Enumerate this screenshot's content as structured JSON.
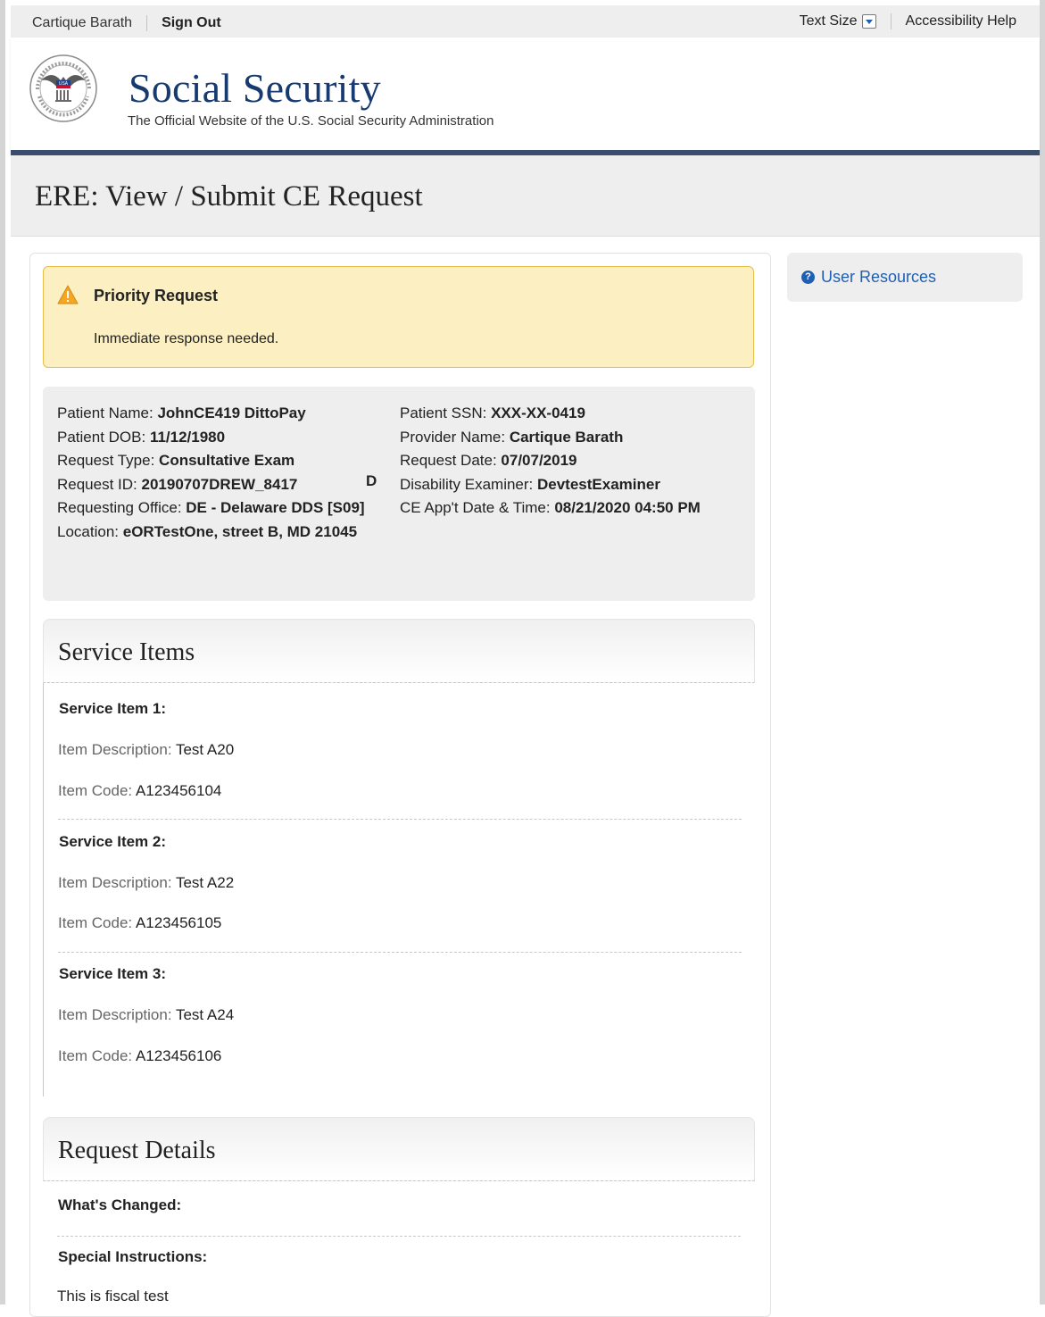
{
  "utility_bar": {
    "user_name": "Cartique Barath",
    "sign_out": "Sign Out",
    "text_size": "Text Size",
    "accessibility_help": "Accessibility Help"
  },
  "header": {
    "title": "Social Security",
    "subtitle": "The Official Website of the U.S. Social Security Administration",
    "logo_text": "USA"
  },
  "page_title": "ERE: View / Submit CE Request",
  "alert": {
    "title": "Priority Request",
    "message": "Immediate response needed."
  },
  "patient_info": {
    "left": [
      {
        "label": "Patient Name: ",
        "value": "JohnCE419 DittoPay"
      },
      {
        "label": "Patient DOB: ",
        "value": "11/12/1980"
      },
      {
        "label": "Request Type: ",
        "value": "Consultative Exam"
      },
      {
        "label": "Request ID: ",
        "value": "20190707DREW_8417"
      },
      {
        "label": "Requesting Office: ",
        "value": "DE - Delaware DDS [S09]"
      },
      {
        "label": "Location: ",
        "value": "eORTestOne, street B, MD 21045"
      }
    ],
    "stray_letter": "D",
    "right": [
      {
        "label": "Patient SSN: ",
        "value": "XXX-XX-0419"
      },
      {
        "label": "Provider Name: ",
        "value": "Cartique Barath"
      },
      {
        "label": "Request Date: ",
        "value": "07/07/2019"
      },
      {
        "label": "Disability Examiner: ",
        "value": "DevtestExaminer"
      },
      {
        "label": "CE App't Date & Time: ",
        "value": "08/21/2020 04:50 PM"
      }
    ]
  },
  "service_items": {
    "heading": "Service Items",
    "description_label": "Item Description: ",
    "code_label": "Item Code: ",
    "items": [
      {
        "title": "Service Item 1:",
        "description": "Test A20",
        "code": "A123456104"
      },
      {
        "title": "Service Item 2:",
        "description": "Test A22",
        "code": "A123456105"
      },
      {
        "title": "Service Item 3:",
        "description": "Test A24",
        "code": "A123456106"
      }
    ]
  },
  "request_details": {
    "heading": "Request Details",
    "whats_changed_label": "What's Changed:",
    "special_instructions_label": "Special Instructions:",
    "special_instructions_text": "This is fiscal test"
  },
  "sidebar": {
    "user_resources": "User Resources"
  },
  "colors": {
    "brand_blue": "#173a70",
    "header_rule": "#3a4d6b",
    "link_blue": "#1f5fb3",
    "alert_bg": "#fcefc2",
    "alert_border": "#e6be48"
  }
}
